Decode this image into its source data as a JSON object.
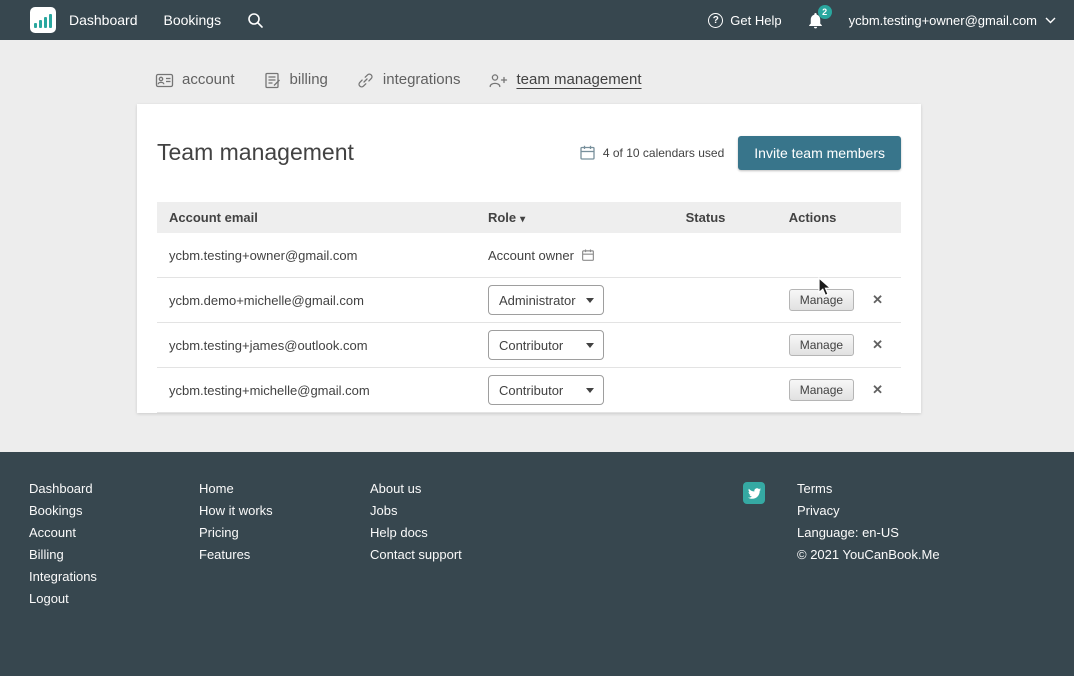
{
  "colors": {
    "navbar_bg": "#37474f",
    "accent_teal": "#2aa79f",
    "button_blue": "#38758b",
    "page_bg": "#ededed"
  },
  "navbar": {
    "links": [
      "Dashboard",
      "Bookings"
    ],
    "get_help_label": "Get Help",
    "notification_count": "2",
    "account_email": "ycbm.testing+owner@gmail.com"
  },
  "tabs": [
    {
      "label": "account"
    },
    {
      "label": "billing"
    },
    {
      "label": "integrations"
    },
    {
      "label": "team management"
    }
  ],
  "main": {
    "title": "Team management",
    "calendars_used": "4 of 10 calendars used",
    "invite_button_label": "Invite team members",
    "table": {
      "headers": {
        "email": "Account email",
        "role": "Role",
        "role_sort": "▾",
        "status": "Status",
        "actions": "Actions"
      },
      "rows": [
        {
          "email": "ycbm.testing+owner@gmail.com",
          "role": "Account owner"
        },
        {
          "email": "ycbm.demo+michelle@gmail.com",
          "role": "Administrator",
          "manage_label": "Manage",
          "remove_label": "✕"
        },
        {
          "email": "ycbm.testing+james@outlook.com",
          "role": "Contributor",
          "manage_label": "Manage",
          "remove_label": "✕"
        },
        {
          "email": "ycbm.testing+michelle@gmail.com",
          "role": "Contributor",
          "manage_label": "Manage",
          "remove_label": "✕"
        }
      ]
    }
  },
  "footer": {
    "nav_links": [
      "Dashboard",
      "Bookings",
      "Account",
      "Billing",
      "Integrations",
      "Logout"
    ],
    "product_links": [
      "Home",
      "How it works",
      "Pricing",
      "Features"
    ],
    "company_links": [
      "About us",
      "Jobs",
      "Help docs",
      "Contact support"
    ],
    "legal_links": [
      "Terms",
      "Privacy"
    ],
    "language": "Language: en-US",
    "copyright": "© 2021 YouCanBook.Me"
  }
}
